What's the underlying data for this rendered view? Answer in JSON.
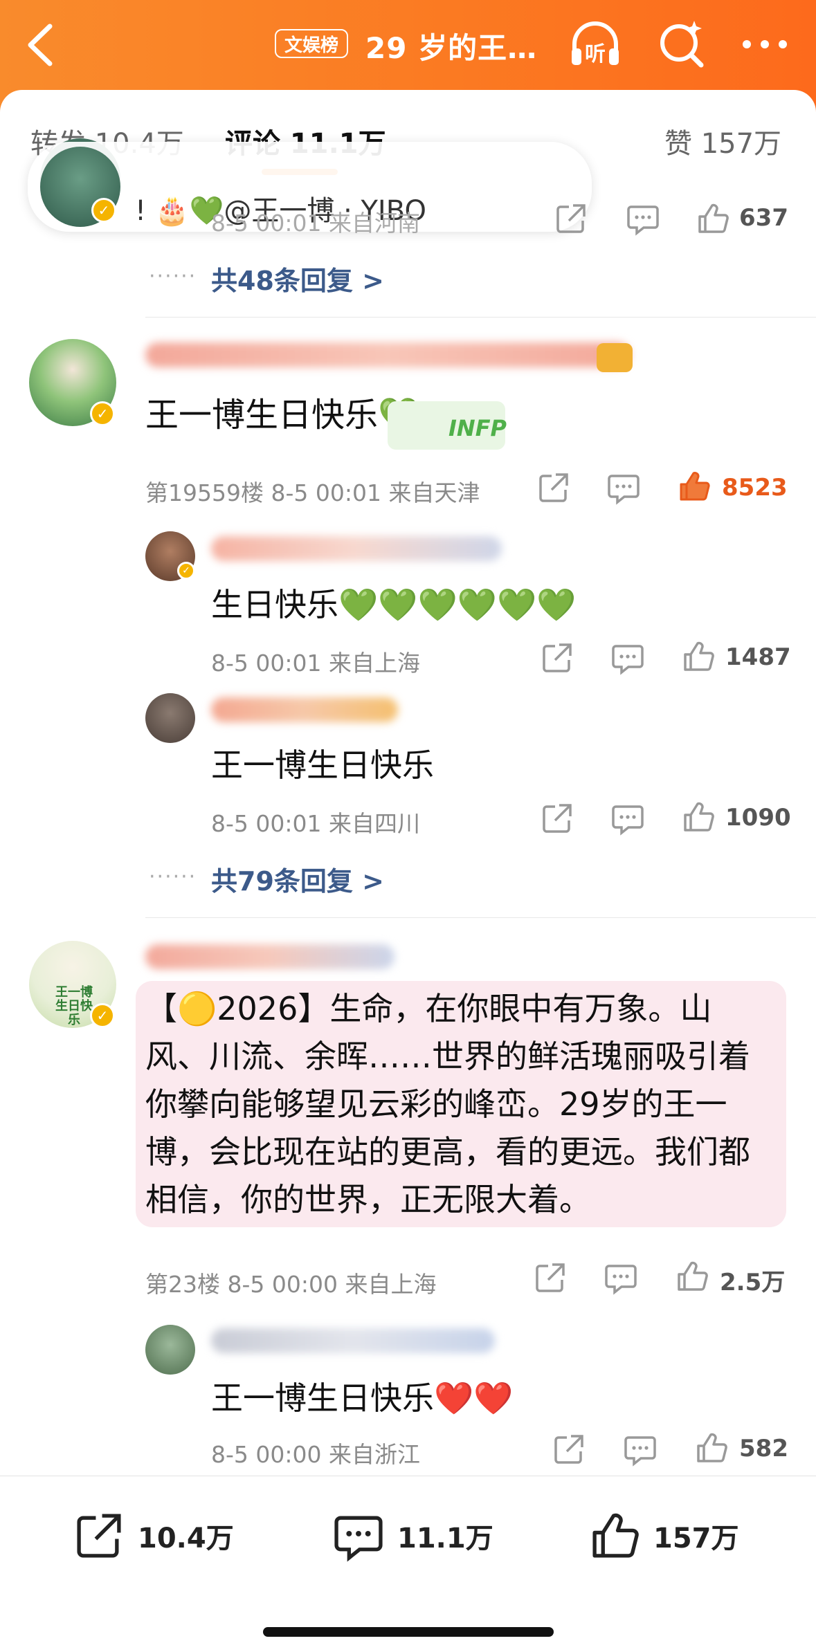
{
  "header": {
    "badge": "文娱榜",
    "title": "29 岁的王…"
  },
  "tabs": {
    "repost": "转发 10.4万",
    "comments": "评论 11.1万",
    "likes": "赞 157万"
  },
  "top_fragment": {
    "text": "!  🎂💚@王一博 · YIBO",
    "meta": "8-5 00:01 来自河南",
    "likes": "637",
    "more_replies": "共48条回复 >"
  },
  "comment1": {
    "text": "王一博生日快乐💚",
    "sticker": "INFP",
    "meta": "第19559楼 8-5 00:01 来自天津",
    "likes": "8523",
    "replies": [
      {
        "text": "生日快乐💚💚💚💚💚💚",
        "meta": "8-5 00:01 来自上海",
        "likes": "1487"
      },
      {
        "text": "王一博生日快乐",
        "meta": "8-5 00:01 来自四川",
        "likes": "1090"
      }
    ],
    "more_replies": "共79条回复 >"
  },
  "comment2": {
    "text": "【🟡2026】生命，在你眼中有万象。山风、川流、余晖……世界的鲜活瑰丽吸引着你攀向能够望见云彩的峰峦。29岁的王一博，会比现在站的更高，看的更远。我们都相信，你的世界，正无限大着。",
    "avatar_text": "王一博 生日快乐",
    "meta": "第23楼 8-5 00:00 来自上海",
    "likes": "2.5万",
    "reply": {
      "text": "王一博生日快乐❤️❤️",
      "meta": "8-5 00:00 来自浙江",
      "likes": "582"
    }
  },
  "bottom_bar": {
    "repost": "10.4万",
    "comments": "11.1万",
    "likes": "157万"
  },
  "colors": {
    "header_orange": "#fb7a22",
    "link_blue": "#3c5a8a",
    "hot_like": "#e85a1a"
  }
}
